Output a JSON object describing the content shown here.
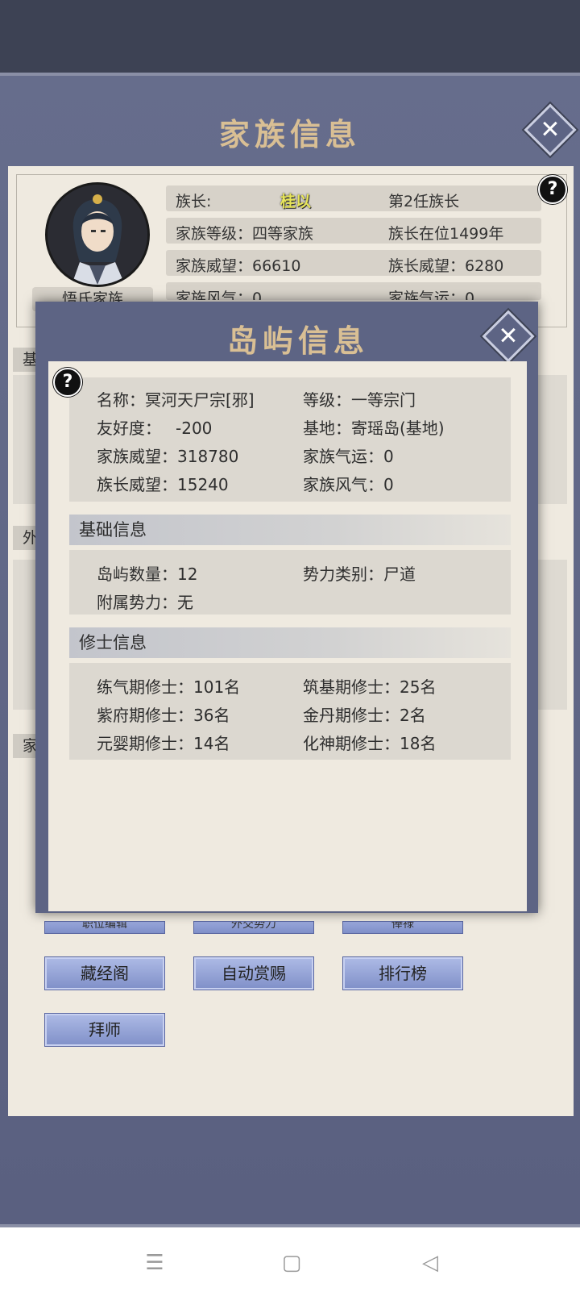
{
  "clan_window": {
    "title": "家族信息",
    "clan_name": "悟氏家族",
    "rows": [
      {
        "left_label": "族长:",
        "name": "桂以",
        "right": "第2任族长"
      },
      {
        "left": "家族等级：四等家族",
        "right": "族长在位1499年"
      },
      {
        "left": "家族威望：66610",
        "right": "族长威望：6280"
      },
      {
        "left": "家族风气：0",
        "right": "家族气运：0"
      }
    ],
    "side_tabs": [
      "基",
      "外",
      "家"
    ],
    "buttons_partial": [
      "职位编辑",
      "外交势力",
      "俸禄"
    ],
    "buttons": [
      "藏经阁",
      "自动赏赐",
      "排行榜",
      "拜师"
    ]
  },
  "island_window": {
    "title": "岛屿信息",
    "help": "?",
    "stats": {
      "name_label": "名称：",
      "name": "冥河天尸宗[邪]",
      "level_label": "等级：",
      "level": "一等宗门",
      "friendship_label": "友好度：",
      "friendship": "-200",
      "base_label": "基地：",
      "base": "寄瑶岛(基地)",
      "prestige_label": "家族威望：",
      "prestige": "318780",
      "luck_label": "家族气运：",
      "luck": "0",
      "leader_prestige_label": "族长威望：",
      "leader_prestige": "15240",
      "morale_label": "家族风气：",
      "morale": "0"
    },
    "basic_section": {
      "title": "基础信息",
      "island_count": "岛屿数量：12",
      "faction_type": "势力类别：尸道",
      "affiliated": "附属势力：无"
    },
    "cultivator_section": {
      "title": "修士信息",
      "qi": "练气期修士：101名",
      "foundation": "筑基期修士：25名",
      "zifu": "紫府期修士：36名",
      "golden": "金丹期修士：2名",
      "nascent": "元婴期修士：14名",
      "spirit": "化神期修士：18名"
    }
  },
  "navbar": {
    "menu_icon": "☰",
    "home_icon": "▢",
    "back_icon": "◁"
  },
  "help_symbol": "?",
  "close_symbol": "✕"
}
